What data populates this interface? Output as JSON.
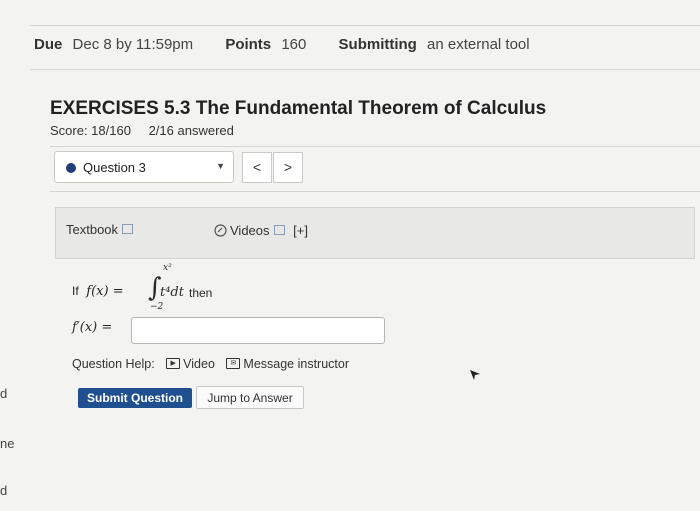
{
  "meta": {
    "due_label": "Due",
    "due_value": "Dec 8 by 11:59pm",
    "points_label": "Points",
    "points_value": "160",
    "submitting_label": "Submitting",
    "submitting_value": "an external tool"
  },
  "assignment": {
    "title": "EXERCISES 5.3 The Fundamental Theorem of Calculus",
    "score": "Score: 18/160",
    "answered": "2/16 answered"
  },
  "question_nav": {
    "selected": "Question 3",
    "caret": "▼",
    "prev": "<",
    "next": ">"
  },
  "resources": {
    "textbook": "Textbook",
    "videos": "Videos",
    "expand": "[+]"
  },
  "problem": {
    "if_text": "If",
    "lhs": "f(x) =",
    "upper_limit": "x²",
    "lower_limit": "−2",
    "integrand": "t⁴dt",
    "then_text": "then",
    "answer_label": "f′(x) =",
    "answer_value": ""
  },
  "help": {
    "label": "Question Help:",
    "video": "Video",
    "message": "Message instructor"
  },
  "buttons": {
    "submit": "Submit Question",
    "jump": "Jump to Answer"
  },
  "edge_fragments": [
    "d",
    "ne",
    "d"
  ],
  "colors": {
    "submit_bg": "#1f4f8f",
    "question_dot": "#1f3e7a",
    "page_bg": "#f3f3f1"
  }
}
